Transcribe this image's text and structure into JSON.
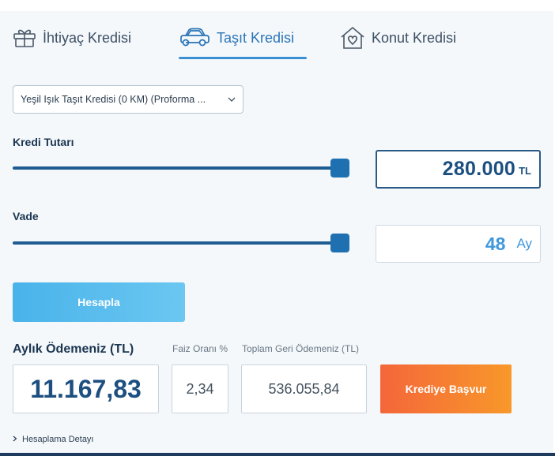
{
  "tabs": [
    {
      "label": "İhtiyaç Kredisi",
      "icon": "gift-icon"
    },
    {
      "label": "Taşıt Kredisi",
      "icon": "car-icon",
      "active": true
    },
    {
      "label": "Konut Kredisi",
      "icon": "house-icon"
    }
  ],
  "product_select": {
    "selected": "Yeşil Işık Taşıt Kredisi (0 KM) (Proforma ..."
  },
  "loan_amount": {
    "label": "Kredi Tutarı",
    "value": "280.000",
    "unit": "TL",
    "slider_fraction": 1.0
  },
  "term": {
    "label": "Vade",
    "value": "48",
    "unit": "Ay",
    "slider_fraction": 1.0
  },
  "calculate_button": "Hesapla",
  "results": {
    "monthly_label": "Aylık Ödemeniz (TL)",
    "monthly_value": "11.167,83",
    "rate_label": "Faiz Oranı %",
    "rate_value": "2,34",
    "total_label": "Toplam Geri Ödemeniz (TL)",
    "total_value": "536.055,84"
  },
  "apply_button": "Krediye Başvur",
  "detail_link": "Hesaplama Detayı",
  "colors": {
    "accent": "#2a74b6",
    "slider": "#1f5c92",
    "apply_start": "#f4663a",
    "apply_end": "#f8982a",
    "calc": "#49b3ea"
  }
}
